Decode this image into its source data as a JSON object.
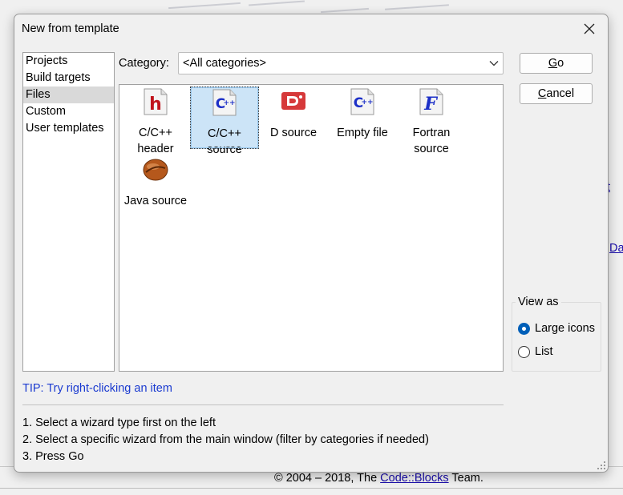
{
  "dialog": {
    "title": "New from template",
    "category_label": "Category:",
    "category_value": "<All categories>",
    "tip": "TIP: Try right-clicking an item",
    "steps": [
      "1. Select a wizard type first on the left",
      "2. Select a specific wizard from the main window (filter by categories if needed)",
      "3. Press Go"
    ]
  },
  "categories": [
    {
      "label": "Projects",
      "selected": false
    },
    {
      "label": "Build targets",
      "selected": false
    },
    {
      "label": "Files",
      "selected": true
    },
    {
      "label": "Custom",
      "selected": false
    },
    {
      "label": "User templates",
      "selected": false
    }
  ],
  "wizards": [
    {
      "line1": "C/C++",
      "line2": "header",
      "icon": "cpp-header-icon",
      "selected": false
    },
    {
      "line1": "C/C++",
      "line2": "source",
      "icon": "cpp-source-icon",
      "selected": true
    },
    {
      "line1": "D source",
      "line2": "",
      "icon": "d-source-icon",
      "selected": false
    },
    {
      "line1": "Empty file",
      "line2": "",
      "icon": "empty-file-icon",
      "selected": false
    },
    {
      "line1": "Fortran",
      "line2": "source",
      "icon": "fortran-source-icon",
      "selected": false
    },
    {
      "line1": "Java source",
      "line2": "",
      "icon": "java-source-icon",
      "selected": false
    }
  ],
  "buttons": {
    "go_mnemonic": "G",
    "go_rest": "o",
    "cancel_mnemonic": "C",
    "cancel_rest": "ancel"
  },
  "view_as": {
    "legend": "View as",
    "options": [
      {
        "label": "Large icons",
        "checked": true
      },
      {
        "label": "List",
        "checked": false
      }
    ]
  },
  "background": {
    "link_fragment_1": "t",
    "link_fragment_2": "Da",
    "footer_prefix": "© 2004 – 2018, The ",
    "footer_link": "Code::Blocks",
    "footer_suffix": " Team."
  },
  "colors": {
    "selection": "#cce4f7",
    "tip_text": "#1a3ad0",
    "radio_checked": "#005fb8"
  }
}
